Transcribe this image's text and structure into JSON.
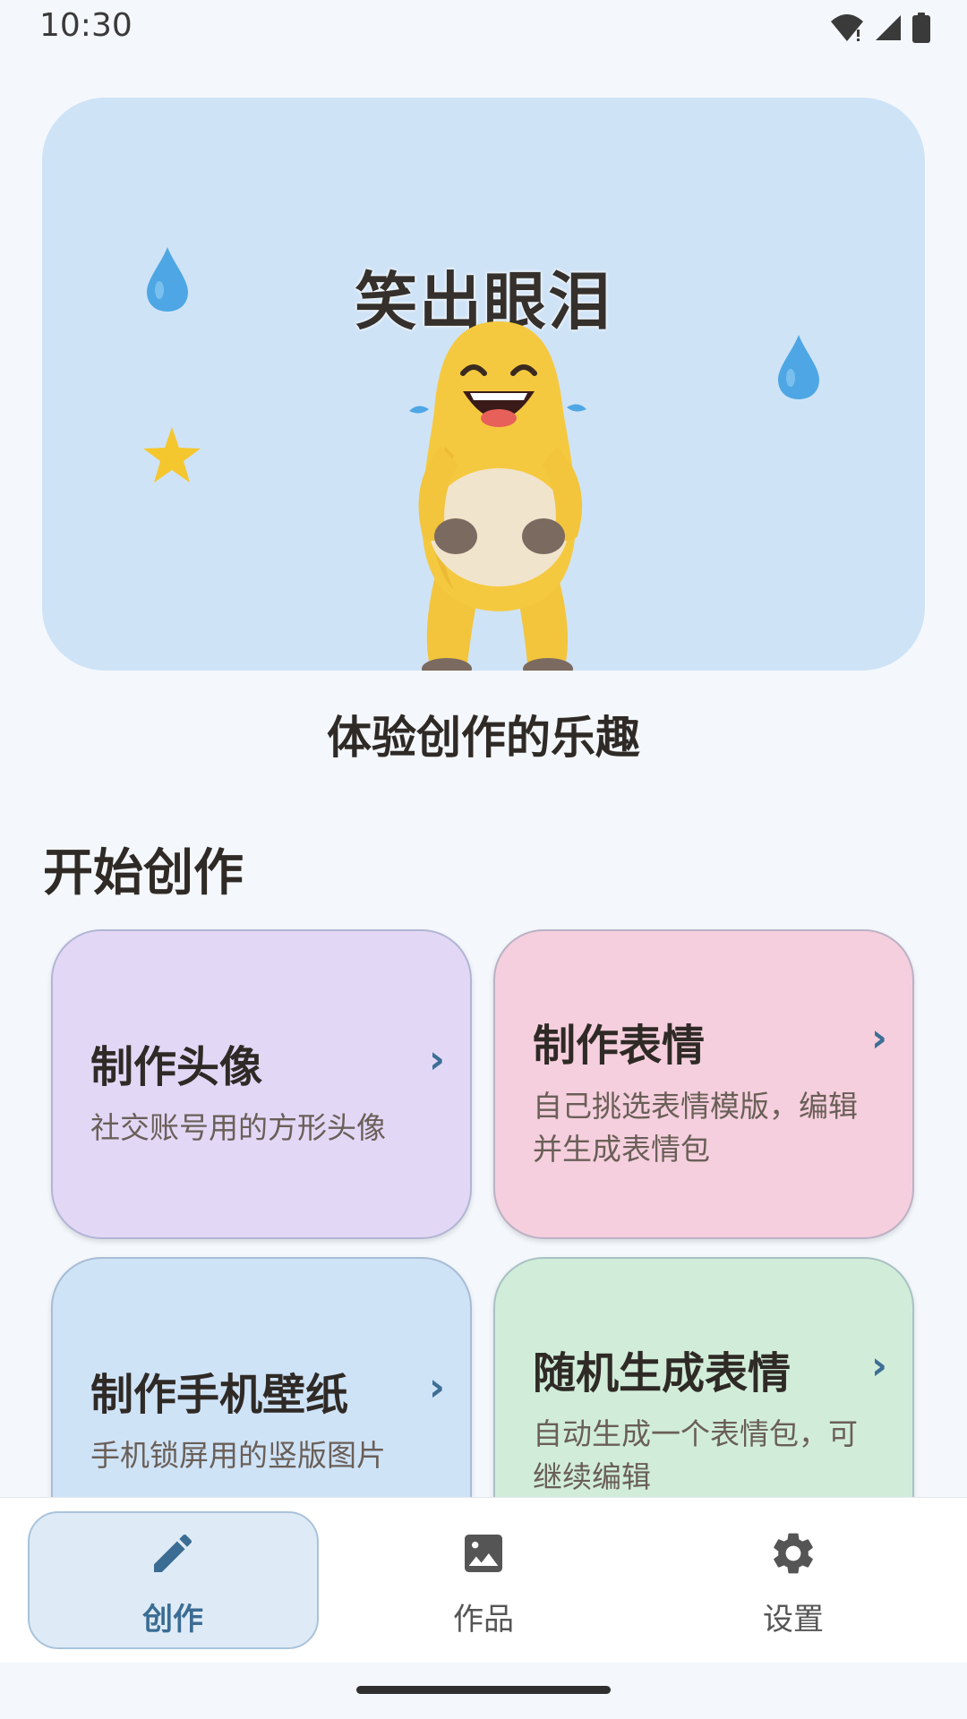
{
  "status_bar": {
    "time": "10:30"
  },
  "hero": {
    "title": "笑出眼泪",
    "caption": "体验创作的乐趣"
  },
  "section": {
    "title": "开始创作"
  },
  "cards": [
    {
      "title": "制作头像",
      "desc": "社交账号用的方形头像",
      "chevron": "›",
      "color": "#e2d8f6"
    },
    {
      "title": "制作表情",
      "desc": "自己挑选表情模版，编辑并生成表情包",
      "chevron": "›",
      "color": "#f5cfdd"
    },
    {
      "title": "制作手机壁纸",
      "desc": "手机锁屏用的竖版图片",
      "chevron": "›",
      "color": "#cfe3f7"
    },
    {
      "title": "随机生成表情",
      "desc": "自动生成一个表情包，可继续编辑",
      "chevron": "›",
      "color": "#d1edd9"
    }
  ],
  "nav": {
    "items": [
      {
        "label": "创作",
        "icon": "pencil-icon",
        "active": true
      },
      {
        "label": "作品",
        "icon": "image-icon",
        "active": false
      },
      {
        "label": "设置",
        "icon": "gear-icon",
        "active": false
      }
    ],
    "active_color": "#3b6c93"
  }
}
